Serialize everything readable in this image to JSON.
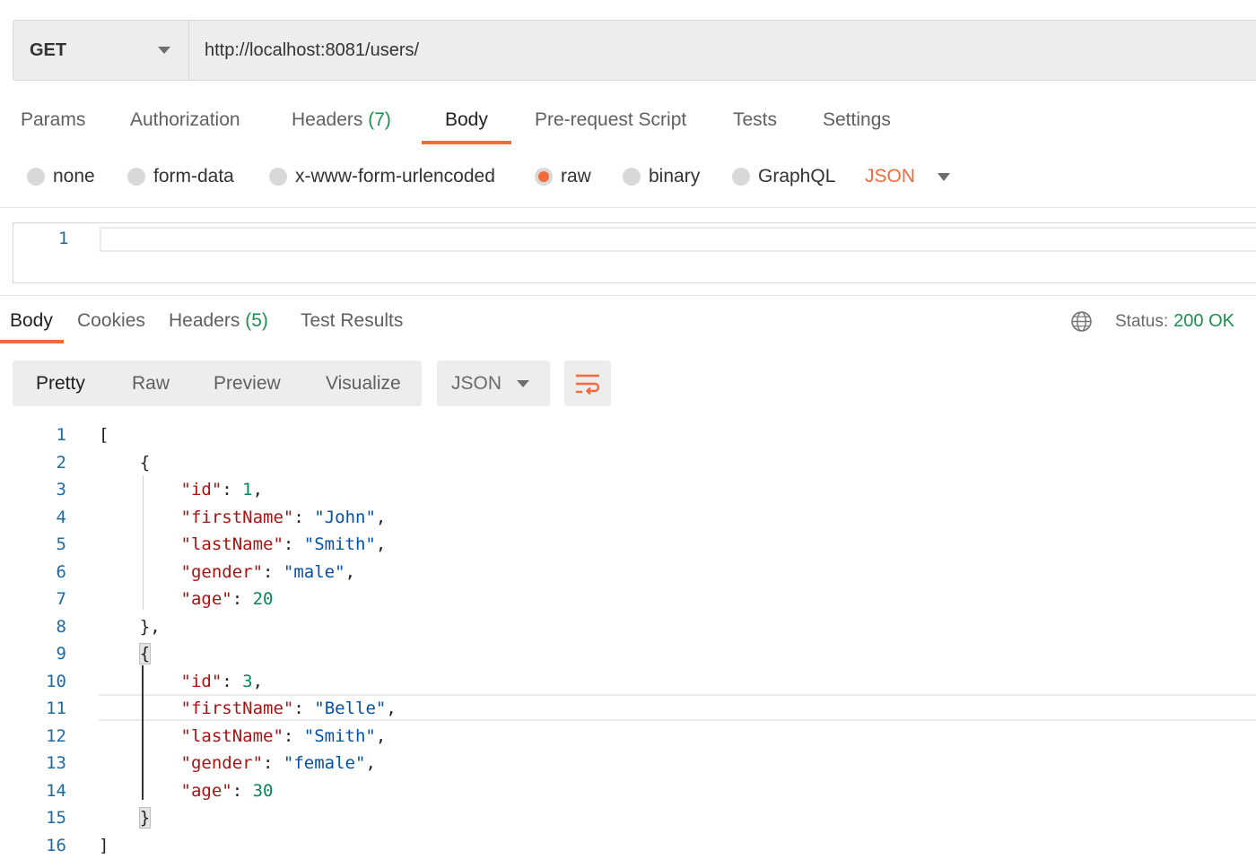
{
  "request": {
    "method": "GET",
    "url": "http://localhost:8081/users/"
  },
  "request_tabs": [
    {
      "label": "Params",
      "count": ""
    },
    {
      "label": "Authorization",
      "count": ""
    },
    {
      "label": "Headers",
      "count": "(7)"
    },
    {
      "label": "Body",
      "count": ""
    },
    {
      "label": "Pre-request Script",
      "count": ""
    },
    {
      "label": "Tests",
      "count": ""
    },
    {
      "label": "Settings",
      "count": ""
    }
  ],
  "active_request_tab": "Body",
  "body_types": [
    "none",
    "form-data",
    "x-www-form-urlencoded",
    "raw",
    "binary",
    "GraphQL"
  ],
  "selected_body_type": "raw",
  "raw_language": "JSON",
  "request_editor": {
    "line_number": "1",
    "content": ""
  },
  "response_tabs": [
    {
      "label": "Body",
      "count": ""
    },
    {
      "label": "Cookies",
      "count": ""
    },
    {
      "label": "Headers",
      "count": "(5)"
    },
    {
      "label": "Test Results",
      "count": ""
    }
  ],
  "active_response_tab": "Body",
  "status": {
    "label": "Status:",
    "value": "200 OK"
  },
  "view_modes": [
    "Pretty",
    "Raw",
    "Preview",
    "Visualize"
  ],
  "active_view_mode": "Pretty",
  "response_format": "JSON",
  "colors": {
    "accent": "#f26b3a",
    "success": "#1e8d52",
    "key": "#a31515",
    "string": "#0451a5",
    "number": "#098658"
  },
  "icons": {
    "globe": "globe-icon",
    "wrap": "wrap-lines-icon"
  },
  "response_lines": [
    {
      "num": "1",
      "text": "["
    },
    {
      "num": "2",
      "text": "    {"
    },
    {
      "num": "3",
      "text": "        \"id\": 1,"
    },
    {
      "num": "4",
      "text": "        \"firstName\": \"John\","
    },
    {
      "num": "5",
      "text": "        \"lastName\": \"Smith\","
    },
    {
      "num": "6",
      "text": "        \"gender\": \"male\","
    },
    {
      "num": "7",
      "text": "        \"age\": 20"
    },
    {
      "num": "8",
      "text": "    },"
    },
    {
      "num": "9",
      "text": "    {"
    },
    {
      "num": "10",
      "text": "        \"id\": 3,"
    },
    {
      "num": "11",
      "text": "        \"firstName\": \"Belle\","
    },
    {
      "num": "12",
      "text": "        \"lastName\": \"Smith\","
    },
    {
      "num": "13",
      "text": "        \"gender\": \"female\","
    },
    {
      "num": "14",
      "text": "        \"age\": 30"
    },
    {
      "num": "15",
      "text": "    }"
    },
    {
      "num": "16",
      "text": "]"
    }
  ]
}
